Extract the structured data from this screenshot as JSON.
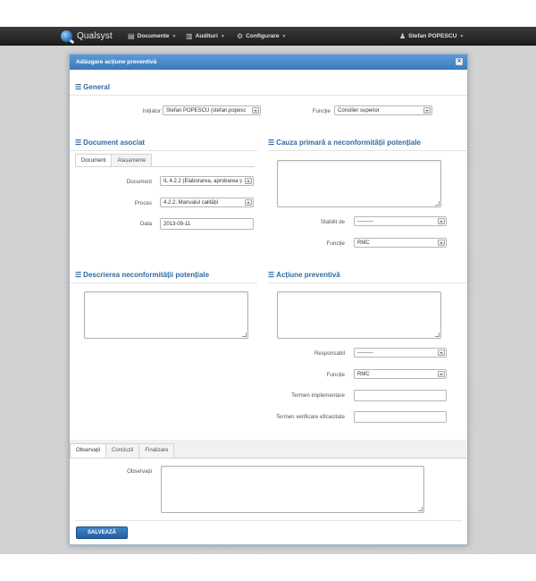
{
  "navbar": {
    "brand": "Qualsyst",
    "menu": [
      {
        "label": "Documente",
        "icon": "document-icon"
      },
      {
        "label": "Audituri",
        "icon": "clipboard-icon"
      },
      {
        "label": "Configurare",
        "icon": "gear-icon"
      }
    ],
    "user": {
      "label": "Stefan POPESCU",
      "icon": "user-icon"
    }
  },
  "modal": {
    "title": "Adăugare acțiune preventivă",
    "close_symbol": "✕"
  },
  "general": {
    "heading": "General",
    "initiator_label": "Inițiator",
    "initiator_value": "Stefan POPESCU (stefan.popesc",
    "functie_label": "Funcție",
    "functie_value": "Consilier superior"
  },
  "document": {
    "heading": "Document asociat",
    "tabs": [
      "Document",
      "Atașamente"
    ],
    "document_label": "Document",
    "document_value": "IL 4.2.2 (Elaborarea, aprobarea ș",
    "proces_label": "Proces",
    "proces_value": "4.2.2. Manualul calității",
    "data_label": "Data",
    "data_value": "2013-09-11"
  },
  "cauza": {
    "heading": "Cauza primară a neconformității potențiale",
    "stabilit_label": "Stabilit de",
    "stabilit_value": "---------",
    "functie_label": "Funcție",
    "functie_value": "RMC"
  },
  "descriere": {
    "heading": "Descrierea neconformității potențiale"
  },
  "actiune": {
    "heading": "Acțiune preventivă",
    "responsabil_label": "Responsabil",
    "responsabil_value": "---------",
    "functie_label": "Funcție",
    "functie_value": "RMC",
    "termen_impl_label": "Termen implementare",
    "termen_impl_value": "",
    "termen_verif_label": "Termen verificare eficacitate",
    "termen_verif_value": ""
  },
  "bottom_tabs": [
    "Observații",
    "Concluzii",
    "Finalizare"
  ],
  "observatii_label": "Observații",
  "save_label": "SALVEAZĂ",
  "section_icon_symbol": "☰",
  "select_arrow": "▾",
  "colors": {
    "accent": "#2f6aa5",
    "header": "#3b79bd",
    "navbar": "#2a2a2a"
  }
}
